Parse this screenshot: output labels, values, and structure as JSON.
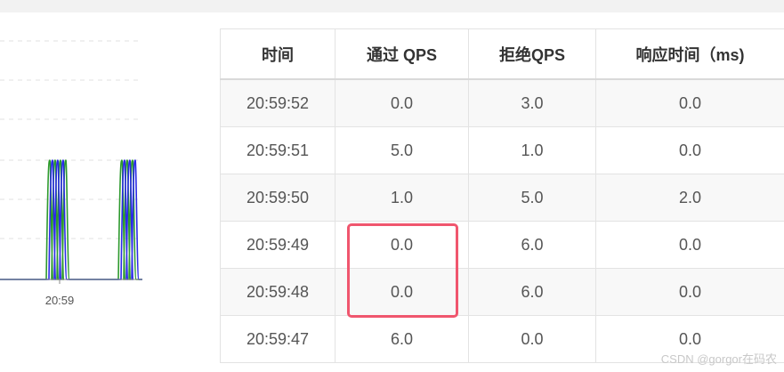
{
  "chart": {
    "x_tick_label": "20:59",
    "series_colors": [
      "#2e9a2e",
      "#2a2ae6"
    ]
  },
  "table": {
    "headers": [
      "时间",
      "通过 QPS",
      "拒绝QPS",
      "响应时间（ms)"
    ],
    "rows": [
      [
        "20:59:52",
        "0.0",
        "3.0",
        "0.0"
      ],
      [
        "20:59:51",
        "5.0",
        "1.0",
        "0.0"
      ],
      [
        "20:59:50",
        "1.0",
        "5.0",
        "2.0"
      ],
      [
        "20:59:49",
        "0.0",
        "6.0",
        "0.0"
      ],
      [
        "20:59:48",
        "0.0",
        "6.0",
        "0.0"
      ],
      [
        "20:59:47",
        "6.0",
        "0.0",
        "0.0"
      ]
    ]
  },
  "watermark": "CSDN @gorgor在码农"
}
